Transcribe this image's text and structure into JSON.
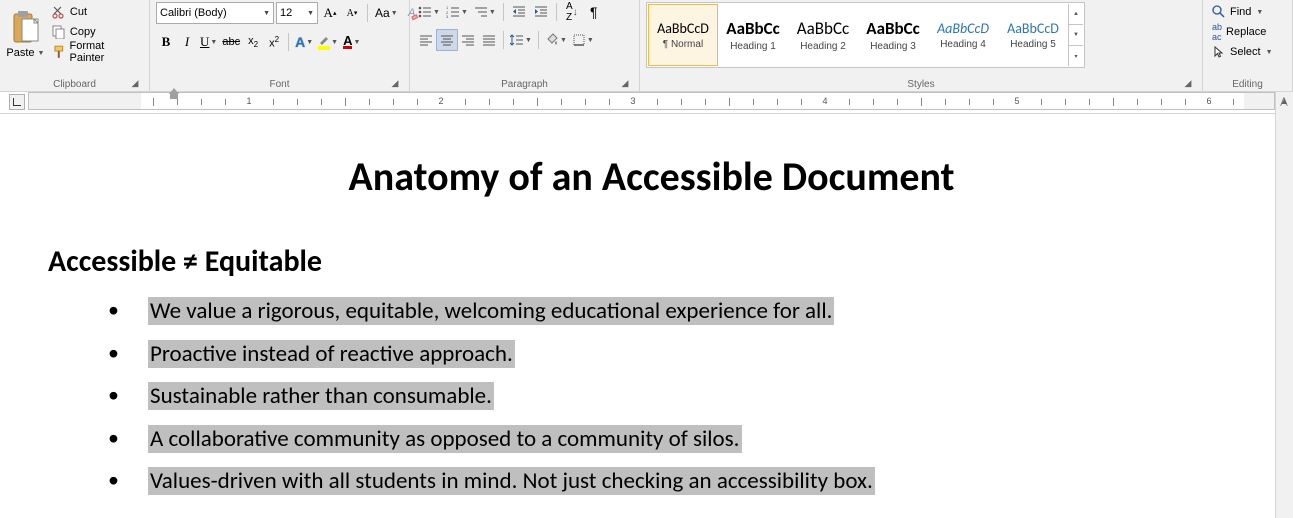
{
  "clipboard": {
    "paste": "Paste",
    "cut": "Cut",
    "copy": "Copy",
    "format_painter": "Format Painter",
    "group": "Clipboard"
  },
  "font": {
    "name": "Calibri (Body)",
    "size": "12",
    "group": "Font"
  },
  "paragraph": {
    "group": "Paragraph"
  },
  "styles": {
    "group": "Styles",
    "items": [
      {
        "preview": "AaBbCcD",
        "name": "¶ Normal",
        "cls": ""
      },
      {
        "preview": "AaBbCc",
        "name": "Heading 1",
        "cls": "bold"
      },
      {
        "preview": "AaBbCc",
        "name": "Heading 2",
        "cls": ""
      },
      {
        "preview": "AaBbCc",
        "name": "Heading 3",
        "cls": "bold"
      },
      {
        "preview": "AaBbCcD",
        "name": "Heading 4",
        "cls": "italic blue"
      },
      {
        "preview": "AaBbCcD",
        "name": "Heading 5",
        "cls": "blue"
      }
    ]
  },
  "editing": {
    "find": "Find",
    "replace": "Replace",
    "select": "Select",
    "group": "Editing"
  },
  "document": {
    "title": "Anatomy of an Accessible Document",
    "h2": "Accessible ≠ Equitable",
    "bullets": [
      "We value a rigorous, equitable, welcoming educational experience for all.",
      "Proactive instead of reactive approach.",
      "Sustainable rather than consumable.",
      "A collaborative community as opposed to a community of silos.",
      "Values-driven with all students in mind. Not just checking an accessibility box."
    ]
  },
  "ruler_numbers": [
    "1",
    "2",
    "3",
    "4",
    "5",
    "6"
  ]
}
